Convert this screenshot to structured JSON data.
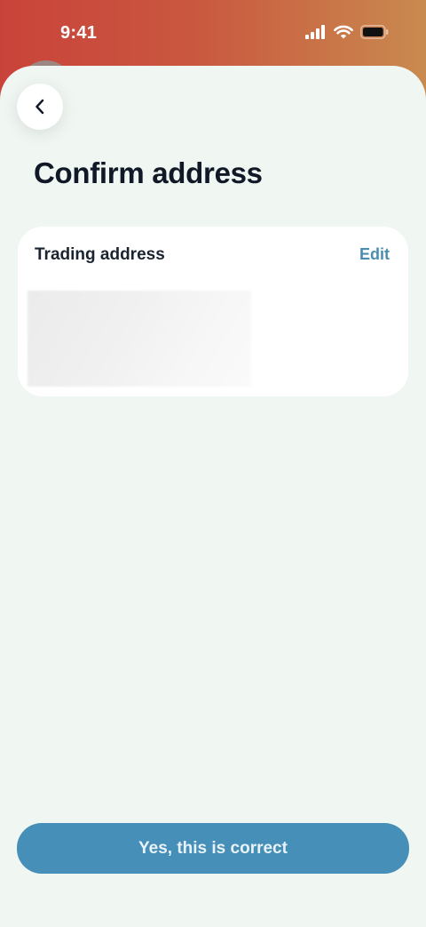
{
  "status_bar": {
    "time": "9:41",
    "icons": [
      "cellular-signal-icon",
      "wifi-icon",
      "battery-icon"
    ]
  },
  "header": {
    "back_icon": "chevron-left-icon",
    "title": "Confirm address"
  },
  "address_card": {
    "heading": "Trading address",
    "edit_label": "Edit"
  },
  "footer": {
    "confirm_label": "Yes, this is correct"
  },
  "colors": {
    "sheet_background": "#f0f6f1",
    "primary_button": "#458fb8",
    "edit_link": "#4a8db0",
    "title_text": "#111827"
  }
}
